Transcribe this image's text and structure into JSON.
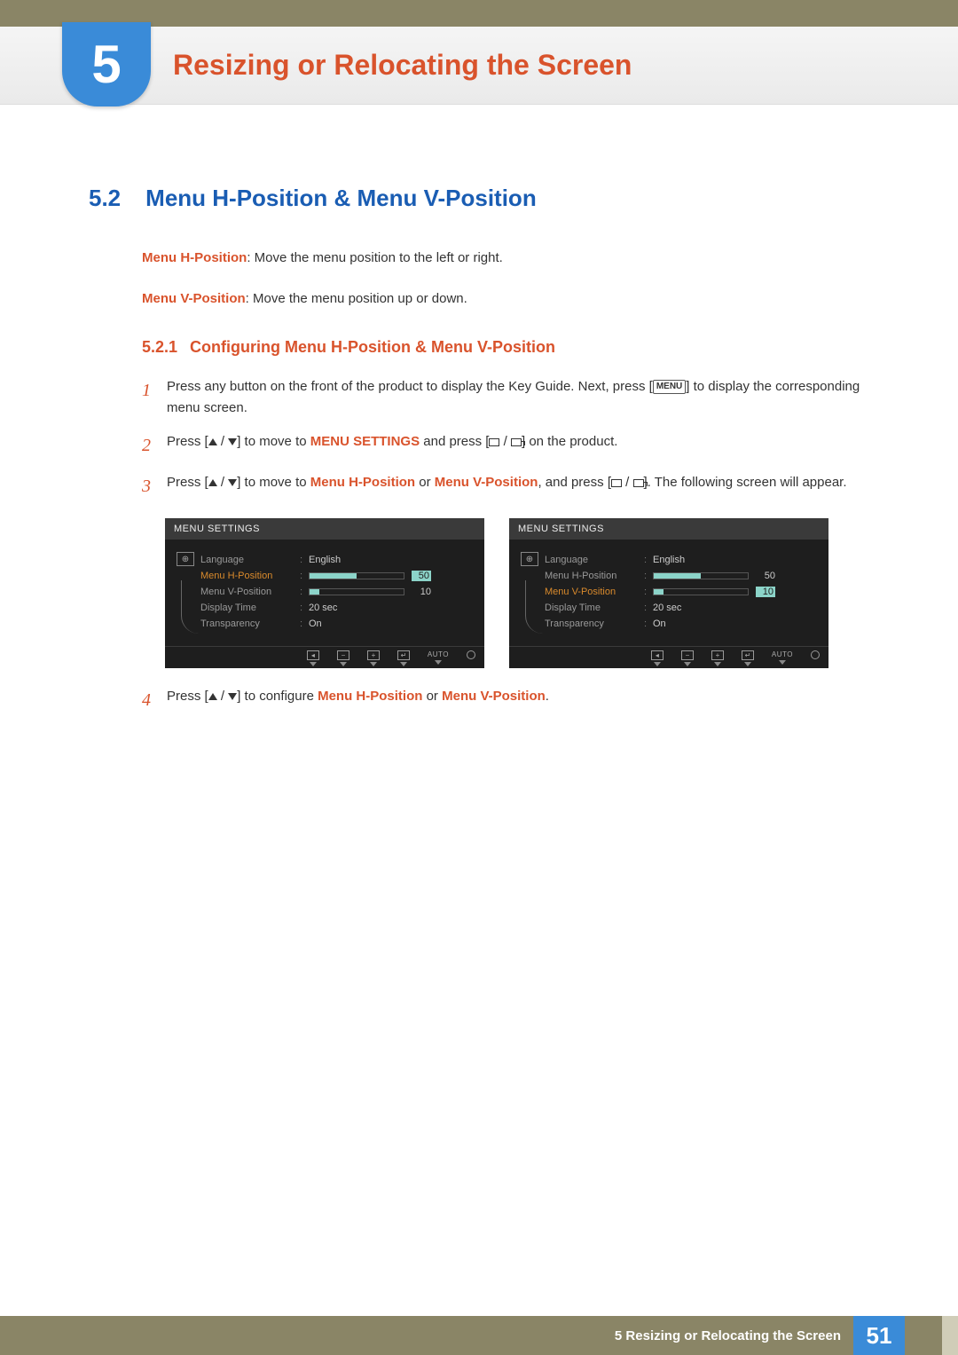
{
  "chapter": {
    "number": "5",
    "title": "Resizing or Relocating the Screen"
  },
  "section": {
    "number": "5.2",
    "title": "Menu H-Position & Menu V-Position"
  },
  "descriptions": {
    "h": {
      "term": "Menu H-Position",
      "text": ": Move the menu position to the left or right."
    },
    "v": {
      "term": "Menu V-Position",
      "text": ": Move the menu position up or down."
    }
  },
  "subsection": {
    "number": "5.2.1",
    "title": "Configuring Menu H-Position & Menu V-Position"
  },
  "steps": {
    "s1": {
      "num": "1",
      "pre": "Press any button on the front of the product to display the Key Guide. Next, press [",
      "key": "MENU",
      "post": "] to display the corresponding menu screen."
    },
    "s2": {
      "num": "2",
      "a": "Press [",
      "b": "] to move to ",
      "hl": "MENU SETTINGS",
      "c": " and press [",
      "d": "] on the product."
    },
    "s3": {
      "num": "3",
      "a": "Press [",
      "b": "] to move to ",
      "hl1": "Menu H-Position",
      "mid": " or ",
      "hl2": "Menu V-Position",
      "c": ", and press [",
      "d": "]. The following screen will appear."
    },
    "s4": {
      "num": "4",
      "a": "Press [",
      "b": "] to configure ",
      "hl1": "Menu H-Position",
      "mid": " or ",
      "hl2": "Menu V-Position",
      "end": "."
    }
  },
  "osd": {
    "title": "MENU SETTINGS",
    "items": {
      "language": {
        "label": "Language",
        "value": "English"
      },
      "hpos": {
        "label": "Menu H-Position",
        "value": "50",
        "fill": 50
      },
      "vpos": {
        "label": "Menu V-Position",
        "value": "10",
        "fill": 10
      },
      "dtime": {
        "label": "Display Time",
        "value": "20 sec"
      },
      "transp": {
        "label": "Transparency",
        "value": "On"
      }
    },
    "footer": {
      "auto": "AUTO"
    }
  },
  "footer": {
    "chapter": "5 Resizing or Relocating the Screen",
    "page": "51"
  }
}
